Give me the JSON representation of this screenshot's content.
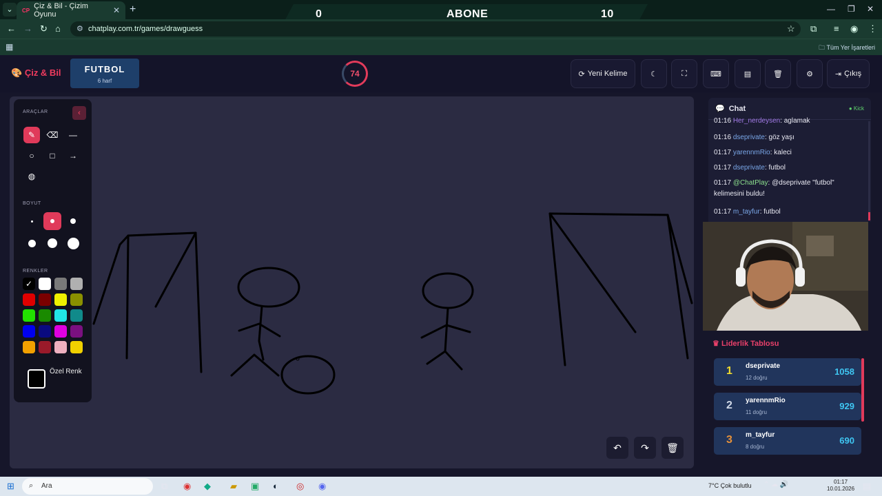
{
  "browser": {
    "tab_title": "Çiz & Bil - Çizim Oyunu",
    "tab_favicon": "CP",
    "url": "chatplay.com.tr/games/drawguess",
    "bookmarks_all": "Tüm Yer İşaretleri",
    "stream_banner": {
      "left": "0",
      "center": "ABONE",
      "right": "10"
    }
  },
  "header": {
    "logo": "Çiz & Bil",
    "word": "FUTBOL",
    "word_hint": "6 harf",
    "timer": "74",
    "new_word_label": "Yeni Kelime",
    "exit_label": "Çıkış"
  },
  "tools": {
    "section_tools": "ARAÇLAR",
    "section_size": "BOYUT",
    "section_colors": "RENKLER",
    "custom_color": "Özel Renk",
    "colors": [
      "#000000",
      "#ffffff",
      "#7a7a7a",
      "#b0b0b0",
      "#e00000",
      "#7a0000",
      "#eef000",
      "#8a9000",
      "#22e000",
      "#1a8a00",
      "#22e5e5",
      "#108a8a",
      "#0000ee",
      "#0a0a80",
      "#e000e0",
      "#7a1080",
      "#f2a000",
      "#9a1a2a",
      "#eeb0c0",
      "#f0d000"
    ]
  },
  "chat": {
    "title": "Chat",
    "platform": "Kick",
    "messages": [
      {
        "time": "01:16",
        "user": "Her_nerdeysen",
        "text": ": aglamak"
      },
      {
        "time": "01:16",
        "user": "dseprivate",
        "text": ": göz yaşı"
      },
      {
        "time": "01:17",
        "user": "yarennmRio",
        "text": ": kaleci"
      },
      {
        "time": "01:17",
        "user": "dseprivate",
        "text": ": futbol"
      },
      {
        "time": "01:17",
        "user": "@ChatPlay",
        "text": ": @dseprivate \"futbol\" kelimesini buldu!"
      },
      {
        "time": "01:17",
        "user": "m_tayfur",
        "text": ": futbol"
      }
    ]
  },
  "leaderboard": {
    "title": "Liderlik Tablosu",
    "rows": [
      {
        "rank": "1",
        "name": "dseprivate",
        "correct": "12 doğru",
        "score": "1058"
      },
      {
        "rank": "2",
        "name": "yarennmRio",
        "correct": "11 doğru",
        "score": "929"
      },
      {
        "rank": "3",
        "name": "m_tayfur",
        "correct": "8 doğru",
        "score": "690"
      }
    ]
  },
  "taskbar": {
    "search": "Ara",
    "weather": "7°C  Çok bulutlu",
    "time": "01:17",
    "date": "10.01.2026"
  }
}
